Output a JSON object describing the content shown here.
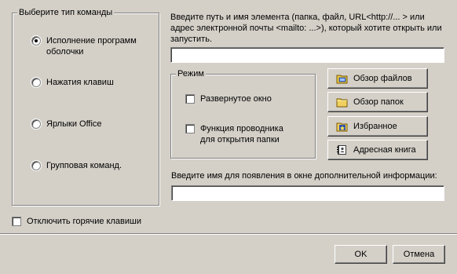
{
  "command_type": {
    "legend": "Выберите тип команды",
    "options": [
      {
        "label": "Исполнение программ\nоболочки",
        "checked": true
      },
      {
        "label": "Нажатия клавиш",
        "checked": false
      },
      {
        "label": "Ярлыки Office",
        "checked": false
      },
      {
        "label": "Групповая команд.",
        "checked": false
      }
    ]
  },
  "path": {
    "prompt": "Введите путь и имя элемента (папка, файл, URL<http://... > или адрес электронной почты <mailto: ...>), который хотите открыть или запустить.",
    "value": ""
  },
  "mode": {
    "legend": "Режим",
    "maximized_label": "Развернутое окно",
    "maximized_checked": false,
    "explorer_label": "Функция проводника\nдля открытия папки",
    "explorer_checked": false
  },
  "buttons": {
    "browse_files": "Обзор файлов",
    "browse_folders": "Обзор папок",
    "favorites": "Избранное",
    "address_book": "Адресная книга"
  },
  "info": {
    "prompt": "Введите имя для появления в окне дополнительной информации:",
    "value": ""
  },
  "disable_hotkeys": {
    "label": "Отключить горячие клавиши",
    "checked": false
  },
  "dialog": {
    "ok": "OK",
    "cancel": "Отмена"
  }
}
